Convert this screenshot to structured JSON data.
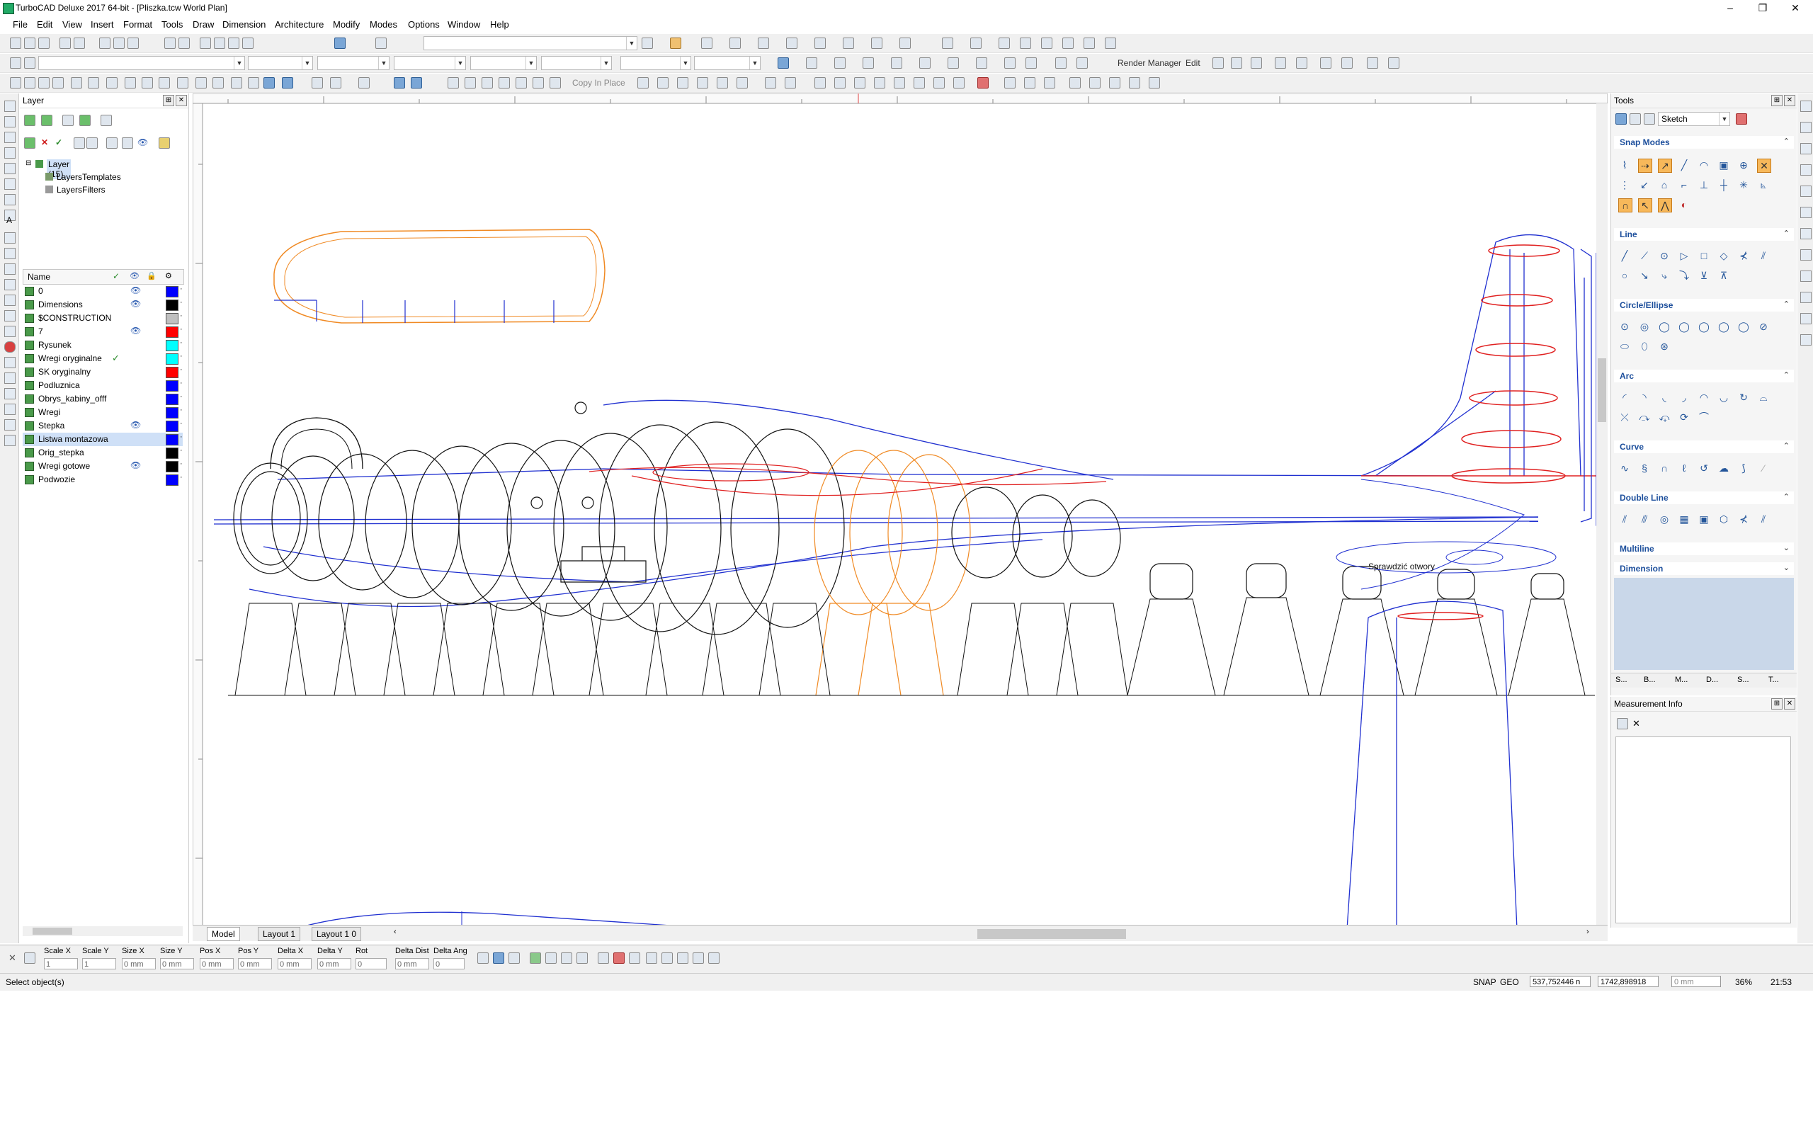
{
  "window": {
    "title": "TurboCAD Deluxe 2017 64-bit - [Pliszka.tcw World Plan]",
    "min": "–",
    "max": "❐",
    "close": "✕"
  },
  "menu": [
    "File",
    "Edit",
    "View",
    "Insert",
    "Format",
    "Tools",
    "Draw",
    "Dimension",
    "Architecture",
    "Modify",
    "Modes",
    "Options",
    "Window",
    "Help"
  ],
  "toolbar": {
    "render_manager": "Render Manager",
    "edit": "Edit",
    "copy_in_place": "Copy In Place"
  },
  "layer_panel": {
    "title": "Layer",
    "tree": [
      "Layer (15)",
      "LayersTemplates",
      "LayersFilters"
    ],
    "columns": [
      "Name",
      "✓",
      "👁",
      "🔒",
      "⚙"
    ],
    "rows": [
      {
        "name": "0",
        "active": false,
        "visible": true,
        "color": "#0000ff"
      },
      {
        "name": "Dimensions",
        "active": false,
        "visible": true,
        "color": "#000000"
      },
      {
        "name": "$CONSTRUCTION",
        "active": false,
        "visible": false,
        "color": "#c0c0c0"
      },
      {
        "name": "7",
        "active": false,
        "visible": true,
        "color": "#ff0000"
      },
      {
        "name": "Rysunek",
        "active": false,
        "visible": false,
        "color": "#00ffff"
      },
      {
        "name": "Wregi oryginalne",
        "active": true,
        "visible": false,
        "color": "#00ffff"
      },
      {
        "name": "SK oryginalny",
        "active": false,
        "visible": false,
        "color": "#ff0000"
      },
      {
        "name": "Podluznica",
        "active": false,
        "visible": false,
        "color": "#0000ff"
      },
      {
        "name": "Obrys_kabiny_offf",
        "active": false,
        "visible": false,
        "color": "#0000ff"
      },
      {
        "name": "Wregi",
        "active": false,
        "visible": false,
        "color": "#0000ff"
      },
      {
        "name": "Stepka",
        "active": false,
        "visible": true,
        "color": "#0000ff"
      },
      {
        "name": "Listwa montazowa",
        "active": false,
        "visible": false,
        "color": "#0000ff"
      },
      {
        "name": "Orig_stepka",
        "active": false,
        "visible": false,
        "color": "#000000"
      },
      {
        "name": "Wregi gotowe",
        "active": false,
        "visible": true,
        "color": "#000000"
      },
      {
        "name": "Podwozie",
        "active": false,
        "visible": false,
        "color": "#0000ff"
      }
    ]
  },
  "canvas": {
    "annotation": "Sprawdzić otwory",
    "tabs": [
      "Model",
      "Layout 1",
      "Layout 1 0"
    ]
  },
  "tools_panel": {
    "title": "Tools",
    "mode": "Sketch",
    "sections": [
      "Snap Modes",
      "Line",
      "Circle/Ellipse",
      "Arc",
      "Curve",
      "Double Line",
      "Multiline",
      "Dimension"
    ],
    "bottom_tabs": [
      "S...",
      "B...",
      "M...",
      "D...",
      "S...",
      "T..."
    ]
  },
  "measure_panel": {
    "title": "Measurement Info"
  },
  "inspector": {
    "fields": [
      {
        "label": "Scale X",
        "value": "1"
      },
      {
        "label": "Scale Y",
        "value": "1"
      },
      {
        "label": "Size X",
        "value": "0 mm"
      },
      {
        "label": "Size Y",
        "value": "0 mm"
      },
      {
        "label": "Pos X",
        "value": "0 mm"
      },
      {
        "label": "Pos Y",
        "value": "0 mm"
      },
      {
        "label": "Delta X",
        "value": "0 mm"
      },
      {
        "label": "Delta Y",
        "value": "0 mm"
      },
      {
        "label": "Rot",
        "value": "0"
      },
      {
        "label": "Delta Dist",
        "value": "0 mm"
      },
      {
        "label": "Delta Ang",
        "value": "0"
      }
    ]
  },
  "status": {
    "message": "Select object(s)",
    "snap": "SNAP",
    "geo": "GEO",
    "x": "537,752446 n",
    "y": "1742,898918",
    "z": "0 mm",
    "zoom": "36%",
    "time": "21:53"
  },
  "colors": {
    "accent_blue": "#1d4f9c",
    "orange": "#f7b85a"
  }
}
